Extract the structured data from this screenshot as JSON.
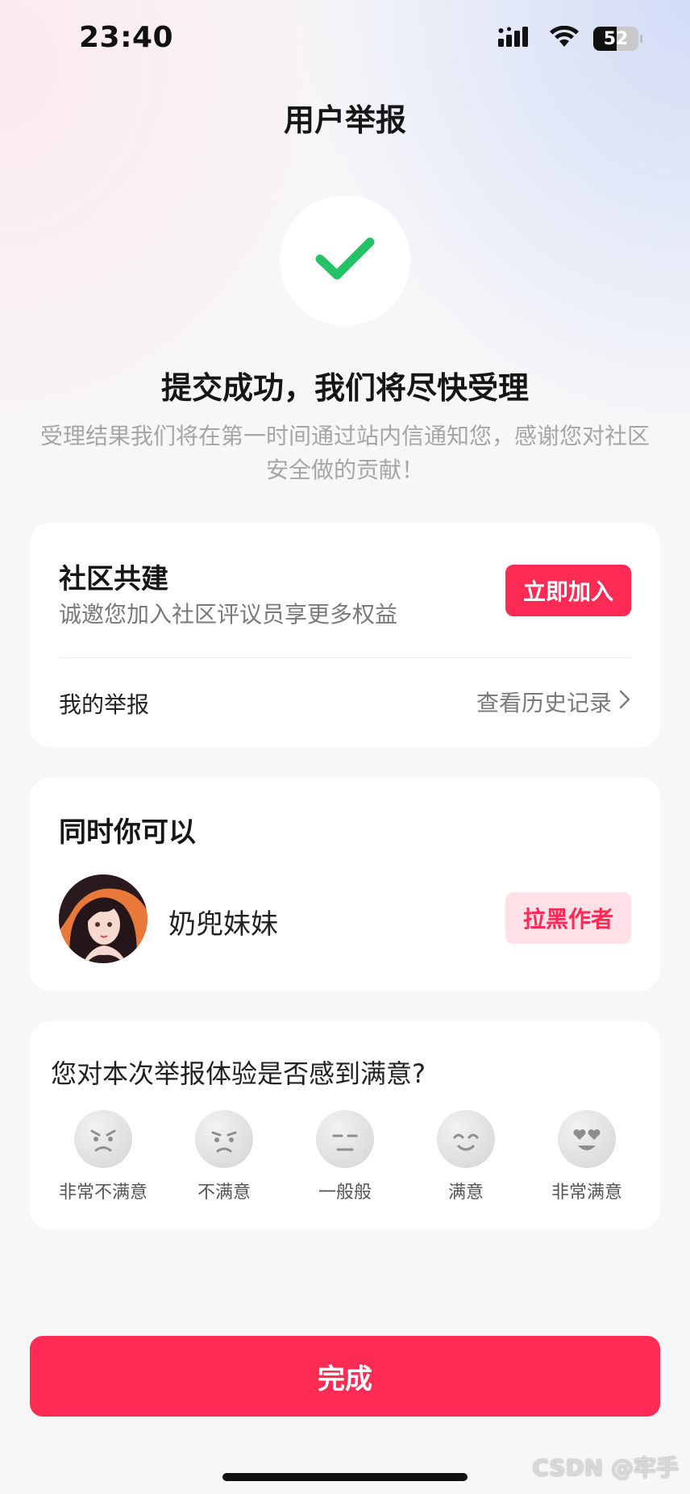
{
  "status_bar": {
    "time": "23:40",
    "battery": "52",
    "icons": [
      "signal-icon",
      "wifi-icon",
      "battery-icon"
    ]
  },
  "header": {
    "title": "用户举报"
  },
  "success": {
    "icon": "checkmark-icon",
    "title": "提交成功，我们将尽快受理",
    "description": "受理结果我们将在第一时间通过站内信通知您，感谢您对社区安全做的贡献！"
  },
  "community": {
    "title": "社区共建",
    "subtitle": "诚邀您加入社区评议员享更多权益",
    "join_label": "立即加入",
    "my_reports_label": "我的举报",
    "history_label": "查看历史记录"
  },
  "actions": {
    "title": "同时你可以",
    "author_name": "奶兜妹妹",
    "block_label": "拉黑作者"
  },
  "feedback": {
    "question": "您对本次举报体验是否感到满意?",
    "options": [
      {
        "label": "非常不满意",
        "icon": "very-dissatisfied-face-icon"
      },
      {
        "label": "不满意",
        "icon": "dissatisfied-face-icon"
      },
      {
        "label": "一般般",
        "icon": "neutral-face-icon"
      },
      {
        "label": "满意",
        "icon": "satisfied-face-icon"
      },
      {
        "label": "非常满意",
        "icon": "heart-eyes-face-icon"
      }
    ]
  },
  "footer": {
    "done_label": "完成",
    "watermark": "CSDN @牢手"
  },
  "colors": {
    "accent": "#fe2c55",
    "accent_light": "#ffe1e7",
    "success_green": "#25c268"
  }
}
